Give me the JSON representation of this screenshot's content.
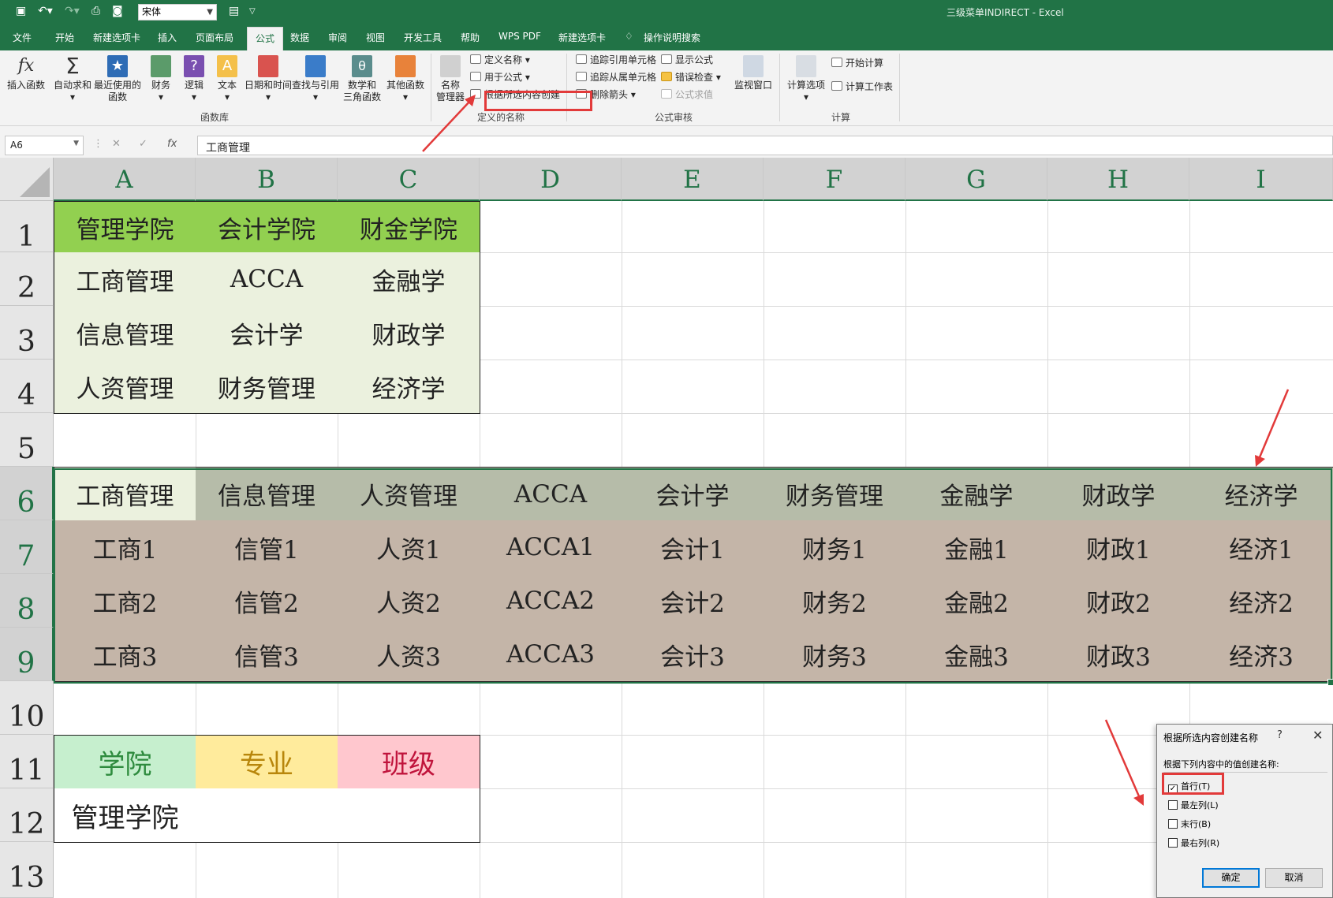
{
  "window": {
    "title": "三级菜单INDIRECT  -  Excel"
  },
  "quick_access": {
    "font_name": "宋体"
  },
  "menu": {
    "tabs": [
      "文件",
      "开始",
      "新建选项卡",
      "插入",
      "页面布局",
      "公式",
      "数据",
      "审阅",
      "视图",
      "开发工具",
      "帮助",
      "WPS PDF",
      "新建选项卡",
      "操作说明搜索"
    ],
    "active": "公式"
  },
  "ribbon": {
    "insert_function": "插入函数",
    "autosum": "自动求和",
    "recent": [
      "最近使用的",
      "函数"
    ],
    "financial": "财务",
    "logical": "逻辑",
    "text": "文本",
    "datetime": "日期和时间",
    "lookup": "查找与引用",
    "math": [
      "数学和",
      "三角函数"
    ],
    "more": "其他函数",
    "group_library": "函数库",
    "name_manager": [
      "名称",
      "管理器"
    ],
    "define_name": "定义名称",
    "use_in_formula": "用于公式",
    "create_from_selection": "根据所选内容创建",
    "group_names": "定义的名称",
    "trace_precedents": "追踪引用单元格",
    "trace_dependents": "追踪从属单元格",
    "remove_arrows": "删除箭头",
    "show_formulas": "显示公式",
    "error_checking": "错误检查",
    "evaluate_formula": "公式求值",
    "group_audit": "公式审核",
    "watch_window": "监视窗口",
    "calc_options": "计算选项",
    "calc_now": "开始计算",
    "calc_sheet": "计算工作表",
    "group_calc": "计算"
  },
  "formula_bar": {
    "name_box": "A6",
    "formula": "工商管理"
  },
  "columns": [
    "A",
    "B",
    "C",
    "D",
    "E",
    "F",
    "G",
    "H",
    "I"
  ],
  "rows": [
    "1",
    "2",
    "3",
    "4",
    "5",
    "6",
    "7",
    "8",
    "9",
    "10",
    "11",
    "12",
    "13"
  ],
  "cells": {
    "A1": "管理学院",
    "B1": "会计学院",
    "C1": "财金学院",
    "A2": "工商管理",
    "B2": "ACCA",
    "C2": "金融学",
    "A3": "信息管理",
    "B3": "会计学",
    "C3": "财政学",
    "A4": "人资管理",
    "B4": "财务管理",
    "C4": "经济学",
    "A6": "工商管理",
    "B6": "信息管理",
    "C6": "人资管理",
    "D6": "ACCA",
    "E6": "会计学",
    "F6": "财务管理",
    "G6": "金融学",
    "H6": "财政学",
    "I6": "经济学",
    "A7": "工商1",
    "B7": "信管1",
    "C7": "人资1",
    "D7": "ACCA1",
    "E7": "会计1",
    "F7": "财务1",
    "G7": "金融1",
    "H7": "财政1",
    "I7": "经济1",
    "A8": "工商2",
    "B8": "信管2",
    "C8": "人资2",
    "D8": "ACCA2",
    "E8": "会计2",
    "F8": "财务2",
    "G8": "金融2",
    "H8": "财政2",
    "I8": "经济2",
    "A9": "工商3",
    "B9": "信管3",
    "C9": "人资3",
    "D9": "ACCA3",
    "E9": "会计3",
    "F9": "财务3",
    "G9": "金融3",
    "H9": "财政3",
    "I9": "经济3",
    "A11": "学院",
    "B11": "专业",
    "C11": "班级",
    "A12": "管理学院"
  },
  "colors": {
    "accent": "#217346",
    "header_row": "#92d050",
    "list_fill": "#ebf1de",
    "row6_fill": "#b6bca9",
    "data_fill": "#c4b5a8",
    "label_college_bg": "#c6efce",
    "label_college_fg": "#2e8b3e",
    "label_major_bg": "#ffeb9c",
    "label_major_fg": "#b8860b",
    "label_class_bg": "#ffc7ce",
    "label_class_fg": "#c0143c",
    "highlight": "#e23a3a"
  },
  "dialog": {
    "title": "根据所选内容创建名称",
    "help": "?",
    "close": "✕",
    "prompt": "根据下列内容中的值创建名称:",
    "options": [
      {
        "label": "首行(T)",
        "checked": true
      },
      {
        "label": "最左列(L)",
        "checked": false
      },
      {
        "label": "末行(B)",
        "checked": false
      },
      {
        "label": "最右列(R)",
        "checked": false
      }
    ],
    "ok": "确定",
    "cancel": "取消"
  }
}
